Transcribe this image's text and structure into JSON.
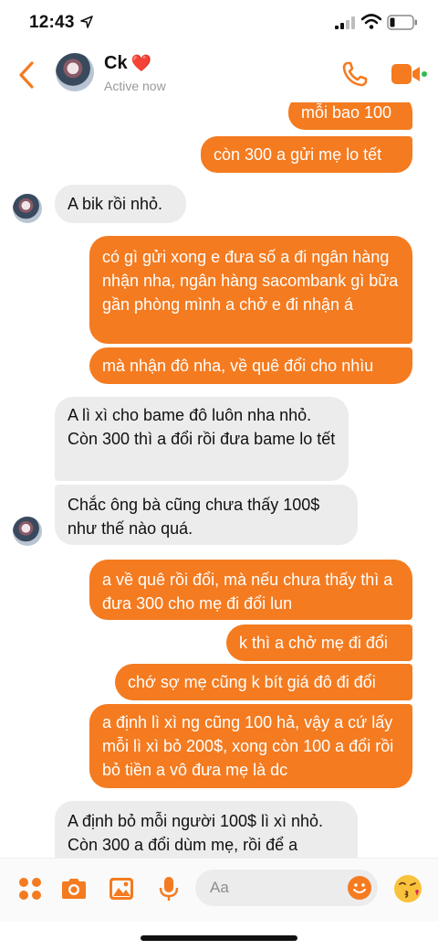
{
  "status_bar": {
    "time": "12:43"
  },
  "header": {
    "contact_name": "Ck",
    "heart": "❤️",
    "status": "Active now",
    "call_icon": "phone-icon",
    "video_icon": "video-icon"
  },
  "messages": [
    {
      "side": "out",
      "text": "mỗi bao 100"
    },
    {
      "side": "out",
      "text": "còn 300 a gửi mẹ lo tết"
    },
    {
      "side": "in",
      "text": "A bik rồi nhỏ."
    },
    {
      "side": "out",
      "text": "có gì gửi xong e đưa số a đi ngân hàng nhận nha, ngân hàng sacombank gì bữa gần phòng mình a chở e đi nhận á"
    },
    {
      "side": "out",
      "text": "mà nhận đô nha, về quê đổi cho nhìu"
    },
    {
      "side": "in",
      "text": "A lì xì cho bame đô luôn nha nhỏ. Còn 300 thì a đổi rồi đưa bame lo tết"
    },
    {
      "side": "in",
      "text": "Chắc ông bà cũng chưa thấy 100$ như thế nào quá."
    },
    {
      "side": "out",
      "text": "a về quê rồi đổi, mà nếu chưa thấy thì a đưa 300 cho mẹ đi đổi lun"
    },
    {
      "side": "out",
      "text": "k thì a chở mẹ đi đổi"
    },
    {
      "side": "out",
      "text": "chớ sợ mẹ cũng k bít giá đô đi đổi"
    },
    {
      "side": "out",
      "text": "a định lì xì ng cũng 100 hả, vậy a cứ lấy mỗi lì xì bỏ 200$, xong còn 100 a đổi rồi bỏ tiền a vô đưa mẹ là dc"
    },
    {
      "side": "in",
      "text": "A định bỏ mỗi người 100$ lì xì nhỏ. Còn 300 a đổi dùm mẹ,  rồi để a"
    }
  ],
  "composer": {
    "placeholder": "Aa",
    "icons": [
      "more-icon",
      "camera-icon",
      "gallery-icon",
      "microphone-icon",
      "emoji-icon",
      "kiss-emoji-icon"
    ]
  },
  "colors": {
    "accent": "#f47b20",
    "incoming_bubble": "#ececec"
  }
}
